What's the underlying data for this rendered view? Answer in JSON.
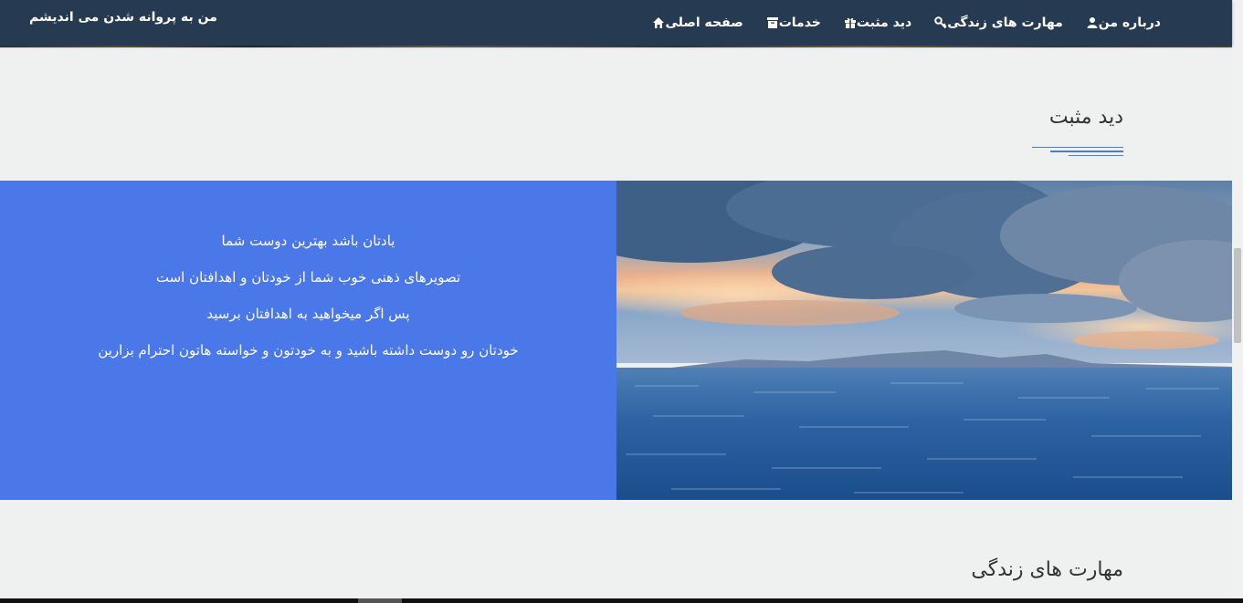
{
  "brand": "من به پروانه شدن می اندیشم",
  "nav": {
    "items": [
      {
        "label": "صفحه اصلی",
        "icon": "home-icon"
      },
      {
        "label": "خدمات",
        "icon": "archive-icon"
      },
      {
        "label": "دید مثبت",
        "icon": "gift-icon"
      },
      {
        "label": "مهارت های زندگی",
        "icon": "key-icon"
      },
      {
        "label": "درباره من",
        "icon": "user-icon"
      }
    ]
  },
  "section_positive": {
    "title": "دید مثبت",
    "lines": [
      "یادتان باشد بهترین دوست شما",
      "تصویرهای ذهنی خوب شما از خودتان و اهدافتان است",
      "پس اگر میخواهید به اهدافتان برسید",
      "خودتان رو دوست داشته باشید و به خودتون و خواسته هاتون احترام بزارین"
    ],
    "accent_color": "#4a78e8"
  },
  "section_life_skills": {
    "title": "مهارت های زندگی"
  },
  "colors": {
    "navbar": "#263a52",
    "background": "#eff0f0",
    "panel": "#4a78e8"
  }
}
